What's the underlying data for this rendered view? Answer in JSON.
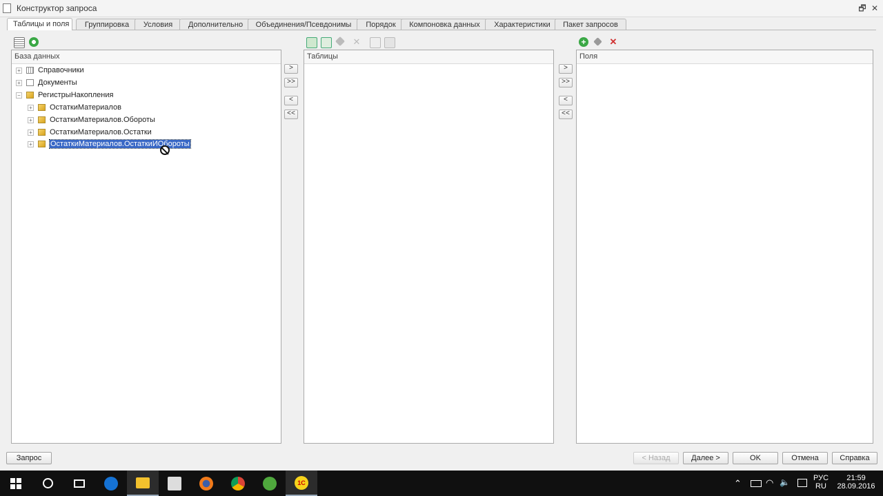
{
  "window": {
    "title": "Конструктор запроса",
    "restore_glyph": "🗗",
    "close_glyph": "✕"
  },
  "tabs": [
    {
      "label": "Таблицы и поля",
      "active": true
    },
    {
      "label": "Группировка"
    },
    {
      "label": "Условия"
    },
    {
      "label": "Дополнительно"
    },
    {
      "label": "Объединения/Псевдонимы"
    },
    {
      "label": "Порядок"
    },
    {
      "label": "Компоновка данных"
    },
    {
      "label": "Характеристики"
    },
    {
      "label": "Пакет запросов"
    }
  ],
  "database_panel": {
    "header": "База данных",
    "tree": [
      {
        "label": "Справочники",
        "expander": "+",
        "icon": "catalog-icon"
      },
      {
        "label": "Документы",
        "expander": "+",
        "icon": "document-icon"
      },
      {
        "label": "РегистрыНакопления",
        "expander": "−",
        "icon": "register-icon"
      },
      {
        "label": "ОстаткиМатериалов",
        "expander": "+",
        "icon": "register-table-icon"
      },
      {
        "label": "ОстаткиМатериалов.Обороты",
        "expander": "+",
        "icon": "register-table-icon"
      },
      {
        "label": "ОстаткиМатериалов.Остатки",
        "expander": "+",
        "icon": "register-table-icon"
      },
      {
        "label": "ОстаткиМатериалов.ОстаткиИОбороты",
        "expander": "+",
        "icon": "register-table-icon",
        "selected": true
      }
    ]
  },
  "tables_panel": {
    "header": "Таблицы"
  },
  "fields_panel": {
    "header": "Поля"
  },
  "transfer_buttons": {
    "add": ">",
    "add_all": ">>",
    "remove": "<",
    "remove_all": "<<"
  },
  "bottom_buttons": {
    "query": "Запрос",
    "back": "< Назад",
    "next": "Далее >",
    "ok": "OK",
    "cancel": "Отмена",
    "help": "Справка"
  },
  "taskbar": {
    "lang_top": "РУС",
    "lang_bottom": "RU",
    "time": "21:59",
    "date": "28.09.2016",
    "app_1c_label": "1С"
  },
  "colors": {
    "selection": "#3968c6",
    "add_green": "#3aa845",
    "delete_red": "#d03030",
    "taskbar": "#101010"
  }
}
